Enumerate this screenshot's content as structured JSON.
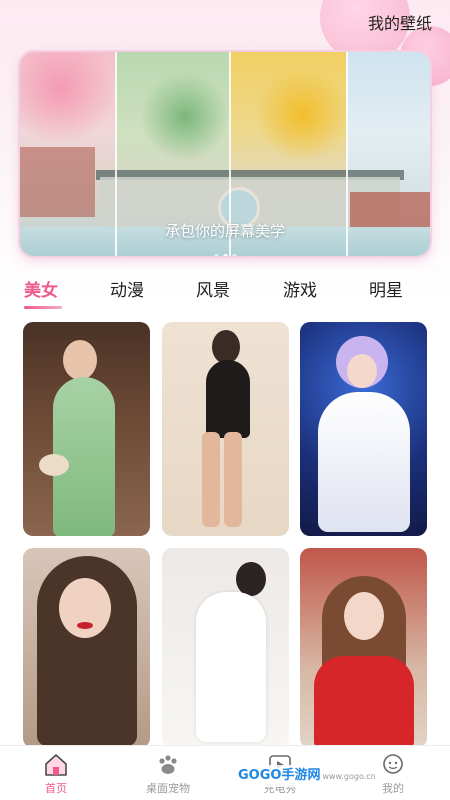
{
  "header": {
    "title": "我的壁纸"
  },
  "banner": {
    "caption": "承包你的屏幕美学",
    "dots": 3,
    "active_dot": 1
  },
  "tabs": [
    {
      "label": "美女",
      "active": true
    },
    {
      "label": "动漫",
      "active": false
    },
    {
      "label": "风景",
      "active": false
    },
    {
      "label": "游戏",
      "active": false
    },
    {
      "label": "明星",
      "active": false
    }
  ],
  "wallpapers": [
    {
      "name": "wallpaper-green-qipao"
    },
    {
      "name": "wallpaper-black-dress"
    },
    {
      "name": "wallpaper-lavender-cosplay"
    },
    {
      "name": "wallpaper-red-lips-portrait"
    },
    {
      "name": "wallpaper-white-dress-bed"
    },
    {
      "name": "wallpaper-red-sweater"
    }
  ],
  "bottom_nav": [
    {
      "label": "首页",
      "icon": "home-icon",
      "active": true
    },
    {
      "label": "桌面宠物",
      "icon": "paw-icon",
      "active": false
    },
    {
      "label": "充电秀",
      "icon": "play-icon",
      "active": false
    },
    {
      "label": "我的",
      "icon": "profile-icon",
      "active": false
    }
  ],
  "watermark": {
    "text": "GOGO手游网",
    "sub": "www.gogo.cn"
  },
  "colors": {
    "accent": "#ef5a8b",
    "nav_inactive": "#9a9a9a"
  }
}
